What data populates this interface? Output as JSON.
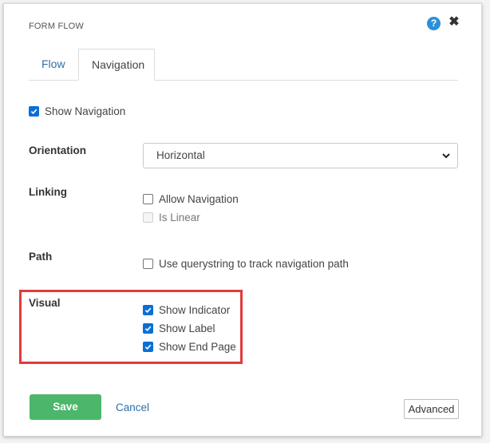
{
  "dialog": {
    "title": "FORM FLOW",
    "help_icon": "?",
    "close_icon": "✖"
  },
  "tabs": [
    {
      "label": "Flow",
      "active": false
    },
    {
      "label": "Navigation",
      "active": true
    }
  ],
  "show_navigation": {
    "label": "Show Navigation",
    "checked": true
  },
  "orientation": {
    "label": "Orientation",
    "value": "Horizontal"
  },
  "linking": {
    "label": "Linking",
    "allow_navigation": {
      "label": "Allow Navigation",
      "checked": false
    },
    "is_linear": {
      "label": "Is Linear",
      "checked": false,
      "disabled": true
    }
  },
  "path": {
    "label": "Path",
    "querystring": {
      "label": "Use querystring to track navigation path",
      "checked": false
    }
  },
  "visual": {
    "label": "Visual",
    "show_indicator": {
      "label": "Show Indicator",
      "checked": true
    },
    "show_label": {
      "label": "Show Label",
      "checked": true
    },
    "show_end_page": {
      "label": "Show End Page",
      "checked": true
    }
  },
  "footer": {
    "save_label": "Save",
    "cancel_label": "Cancel",
    "advanced_label": "Advanced"
  },
  "colors": {
    "accent": "#0b6fd6",
    "save": "#4cb66a",
    "highlight": "#e23b3b",
    "link": "#2f6fa8"
  }
}
